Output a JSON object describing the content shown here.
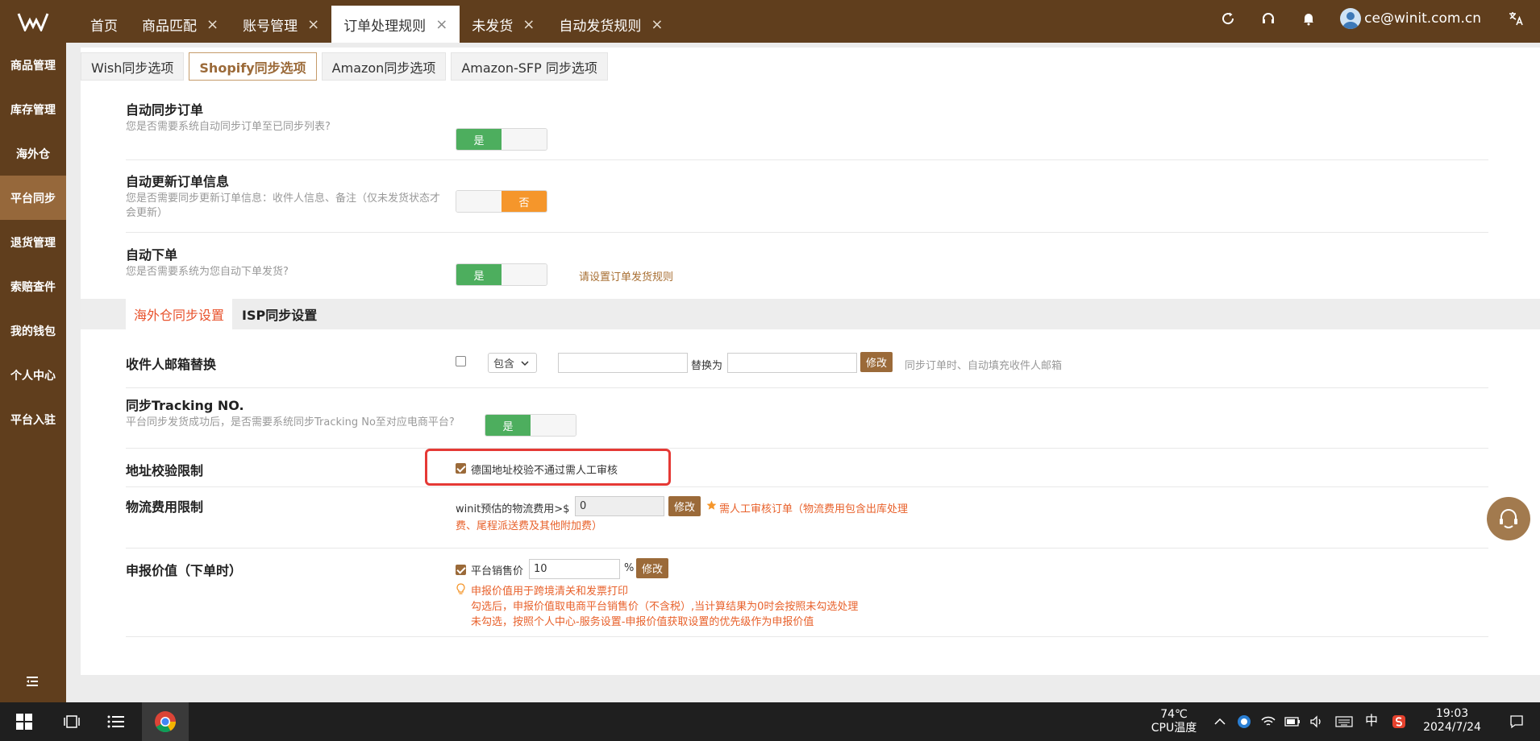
{
  "tabs": [
    {
      "label": "首页",
      "closable": false
    },
    {
      "label": "商品匹配",
      "closable": true
    },
    {
      "label": "账号管理",
      "closable": true
    },
    {
      "label": "订单处理规则",
      "closable": true,
      "active": true
    },
    {
      "label": "未发货",
      "closable": true
    },
    {
      "label": "自动发货规则",
      "closable": true
    }
  ],
  "close_glyph": "×",
  "user": {
    "email": "ce@winit.com.cn"
  },
  "sidebar": {
    "items": [
      {
        "label": "商品管理"
      },
      {
        "label": "库存管理"
      },
      {
        "label": "海外仓"
      },
      {
        "label": "平台同步",
        "active": true
      },
      {
        "label": "退货管理"
      },
      {
        "label": "索赔查件"
      },
      {
        "label": "我的钱包"
      },
      {
        "label": "个人中心"
      },
      {
        "label": "平台入驻"
      }
    ]
  },
  "subtabs": [
    {
      "label": "Wish同步选项"
    },
    {
      "label": "Shopify同步选项",
      "active": true
    },
    {
      "label": "Amazon同步选项"
    },
    {
      "label": "Amazon-SFP 同步选项"
    }
  ],
  "settings": {
    "auto_sync": {
      "title": "自动同步订单",
      "desc": "您是否需要系统自动同步订单至已同步列表?",
      "yes": "是"
    },
    "auto_update": {
      "title": "自动更新订单信息",
      "desc": "您是否需要同步更新订单信息：收件人信息、备注（仅未发货状态才会更新）",
      "no": "否"
    },
    "auto_order": {
      "title": "自动下单",
      "desc": "您是否需要系统为您自动下单发货?",
      "yes": "是",
      "link": "请设置订单发货规则"
    }
  },
  "section_tabs": [
    {
      "label": "海外仓同步设置",
      "active": true
    },
    {
      "label": "ISP同步设置"
    }
  ],
  "email_replace": {
    "title": "收件人邮箱替换",
    "select_value": "包含",
    "replace_label": "替换为",
    "button": "修改",
    "hint": "同步订单时、自动填充收件人邮箱"
  },
  "tracking": {
    "title": "同步Tracking NO.",
    "desc": "平台同步发货成功后，是否需要系统同步Tracking No至对应电商平台?",
    "yes": "是"
  },
  "address": {
    "title": "地址校验限制",
    "checkbox_label": "德国地址校验不通过需人工审核"
  },
  "logistics": {
    "title": "物流费用限制",
    "prefix": "winit预估的物流费用>$",
    "value": "0",
    "button": "修改",
    "note_line1": "需人工审核订单（物流费用包含出库处理",
    "note_line2": "费、尾程派送费及其他附加费）"
  },
  "declare": {
    "title": "申报价值（下单时）",
    "checkbox_label": "平台销售价",
    "value": "10",
    "unit": "%",
    "button": "修改",
    "note1": "申报价值用于跨境清关和发票打印",
    "note2": "勾选后，申报价值取电商平台销售价（不含税）,当计算结果为0时会按照未勾选处理",
    "note3": "未勾选，按照个人中心-服务设置-申报价值获取设置的优先级作为申报价值"
  },
  "taskbar": {
    "temp": "74℃",
    "temp_label": "CPU温度",
    "ime": "中",
    "time": "19:03",
    "date": "2024/7/24"
  },
  "colors": {
    "brand_dark": "#603e1d",
    "brand_active": "#96683b",
    "accent": "#9b6a39",
    "green": "#4dae5e",
    "orange": "#f5962b",
    "highlight_red": "#e53935"
  }
}
